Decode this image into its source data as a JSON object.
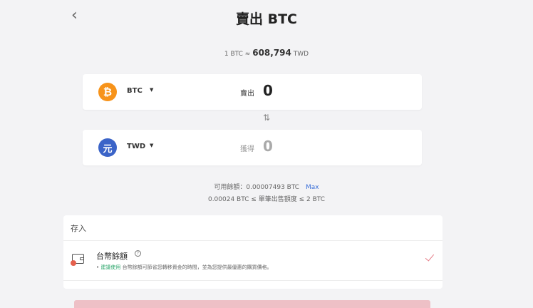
{
  "header": {
    "back_icon": "‹",
    "title": "賣出 BTC"
  },
  "rate": {
    "prefix": "1 BTC ≈",
    "value": "608,794",
    "unit": "TWD"
  },
  "sell_card": {
    "icon": "₿",
    "symbol": "BTC",
    "caret": "▼",
    "action": "賣出",
    "amount": "0",
    "coin_color": "#f7931a"
  },
  "swap_icon": "⇅",
  "get_card": {
    "icon": "元",
    "symbol": "TWD",
    "caret": "▼",
    "action": "獲得",
    "amount": "0",
    "coin_color": "#3b64c8"
  },
  "balance": {
    "text": "可用餘額：0.00007493 BTC",
    "max_label": "Max"
  },
  "limit": {
    "text": "0.00024 BTC ≤ 單筆出售額度 ≤ 2 BTC"
  },
  "deposit": {
    "heading": "存入",
    "option": {
      "name": "台幣餘額",
      "help": "?",
      "note_bullet": "•",
      "note_recommend": "建議使用",
      "note_rest": "台幣餘額可節省您轉移資金的時間，並為您提供最優惠的購買價格。",
      "selected": true
    }
  },
  "colors": {
    "accent_link": "#3b6fd8",
    "check": "#e57a85",
    "submit_bg": "#eec0c6",
    "recommend": "#2aa56a"
  }
}
